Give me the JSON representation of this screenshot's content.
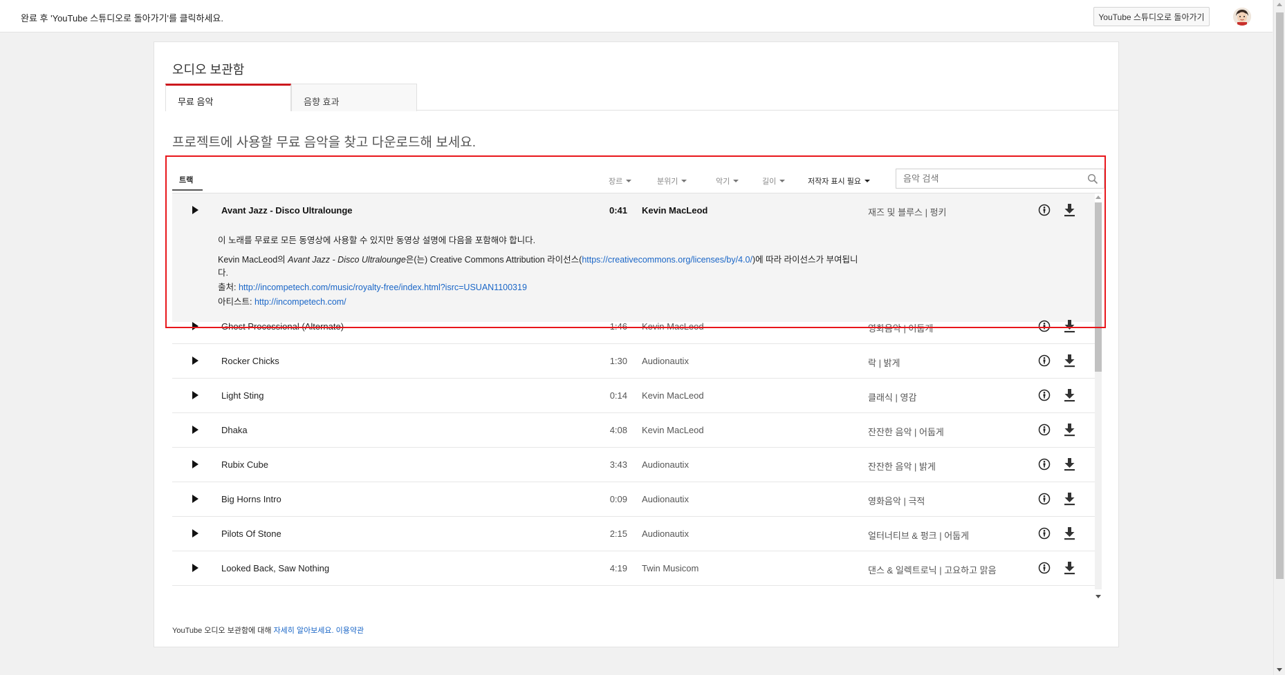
{
  "topbar": {
    "notice": "완료 후 'YouTube 스튜디오로 돌아가기'를 클릭하세요.",
    "return_button": "YouTube 스튜디오로 돌아가기"
  },
  "card": {
    "title": "오디오 보관함",
    "tabs": [
      {
        "label": "무료 음악",
        "active": true
      },
      {
        "label": "음향 효과",
        "active": false
      }
    ],
    "subtitle": "프로젝트에 사용할 무료 음악을 찾고 다운로드해 보세요."
  },
  "filters": {
    "tracks_tab": "트랙",
    "genre": "장르",
    "mood": "분위기",
    "instrument": "악기",
    "duration": "길이",
    "attribution": "저작자 표시 필요",
    "search_placeholder": "음악 검색"
  },
  "tracks": [
    {
      "title": "Avant Jazz - Disco Ultralounge",
      "duration": "0:41",
      "artist": "Kevin MacLeod",
      "genre": "재즈 및 블루스 | 펑키",
      "expanded": true
    },
    {
      "title": "Ghost Processional (Alternate)",
      "duration": "1:46",
      "artist": "Kevin MacLeod",
      "genre": "영화음악 | 어둡게"
    },
    {
      "title": "Rocker Chicks",
      "duration": "1:30",
      "artist": "Audionautix",
      "genre": "락 | 밝게"
    },
    {
      "title": "Light Sting",
      "duration": "0:14",
      "artist": "Kevin MacLeod",
      "genre": "클래식 | 영감"
    },
    {
      "title": "Dhaka",
      "duration": "4:08",
      "artist": "Kevin MacLeod",
      "genre": "잔잔한 음악 | 어둡게"
    },
    {
      "title": "Rubix Cube",
      "duration": "3:43",
      "artist": "Audionautix",
      "genre": "잔잔한 음악 | 밝게"
    },
    {
      "title": "Big Horns Intro",
      "duration": "0:09",
      "artist": "Audionautix",
      "genre": "영화음악 | 극적"
    },
    {
      "title": "Pilots Of Stone",
      "duration": "2:15",
      "artist": "Audionautix",
      "genre": "얼터너티브 & 펑크 | 어둡게"
    },
    {
      "title": "Looked Back, Saw Nothing",
      "duration": "4:19",
      "artist": "Twin Musicom",
      "genre": "댄스 & 일렉트로닉 | 고요하고 맑음"
    }
  ],
  "details": {
    "intro": "이 노래를 무료로 모든 동영상에 사용할 수 있지만 동영상 설명에 다음을 포함해야 합니다.",
    "license_prefix": "Kevin MacLeod의 ",
    "license_title": "Avant Jazz - Disco Ultralounge",
    "license_mid": "은(는) Creative Commons Attribution 라이선스(",
    "license_link": "https://creativecommons.org/licenses/by/4.0/",
    "license_suffix": ")에 따라 라이선스가 부여됩니",
    "license_wrap": "다.",
    "source_label": "출처: ",
    "source_link": "http://incompetech.com/music/royalty-free/index.html?isrc=USUAN1100319",
    "artist_label": "아티스트: ",
    "artist_link": "http://incompetech.com/"
  },
  "footer": {
    "text": "YouTube 오디오 보관함에 대해 ",
    "learn_more": "자세히 알아보세요.",
    "terms": "이용약관"
  },
  "colors": {
    "accent_red": "#cc181e",
    "highlight_red": "#e8161b",
    "link_blue": "#1a66c7"
  }
}
